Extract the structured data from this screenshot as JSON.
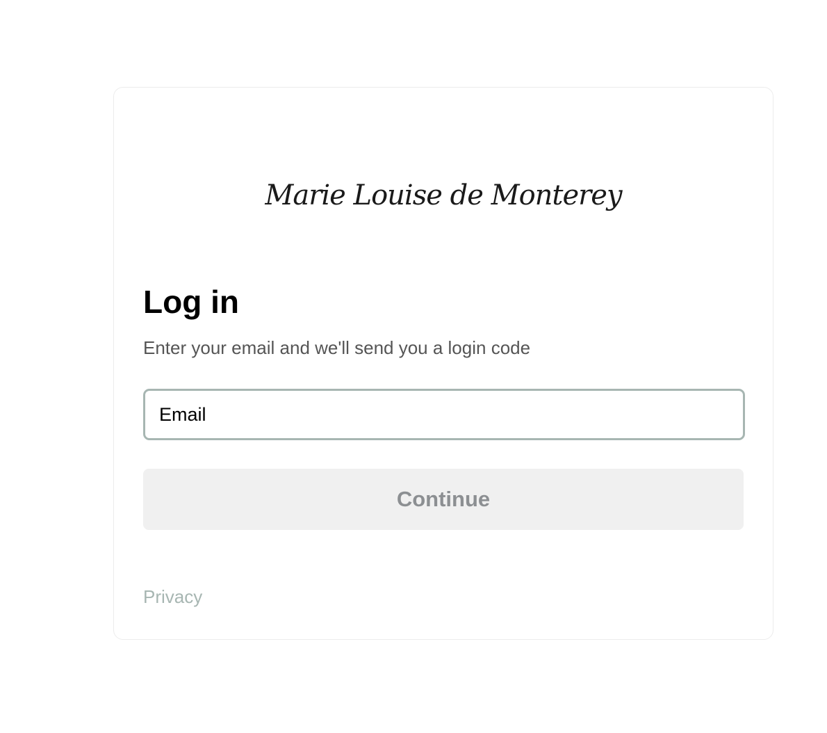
{
  "brand": {
    "logo_text": "Marie Louise de Monterey"
  },
  "login": {
    "title": "Log in",
    "subtitle": "Enter your email and we'll send you a login code",
    "email_placeholder": "Email",
    "email_value": "",
    "continue_label": "Continue"
  },
  "footer": {
    "privacy_label": "Privacy"
  },
  "colors": {
    "input_border": "#a7b6b2",
    "button_bg": "#f0f0f0",
    "button_text": "#8c8f92",
    "link": "#a7b6b2",
    "subtitle": "#555555"
  }
}
